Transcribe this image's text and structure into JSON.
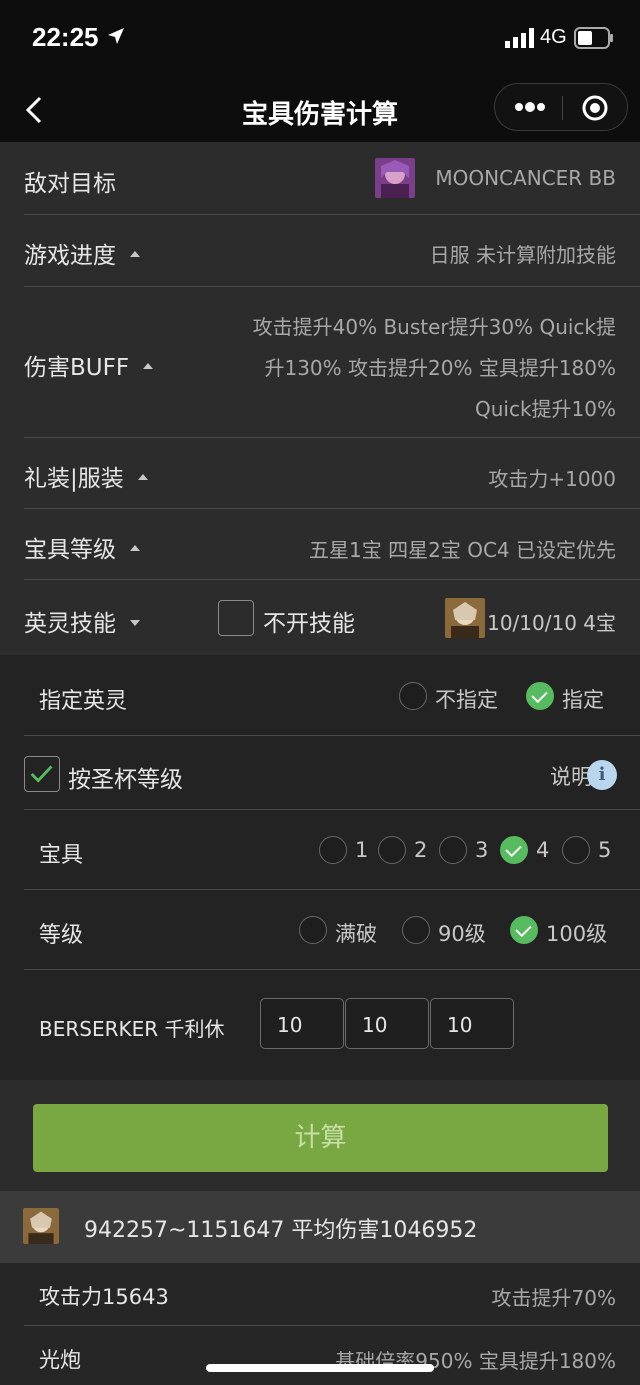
{
  "status": {
    "time": "22:25",
    "network": "4G"
  },
  "nav": {
    "title": "宝具伤害计算"
  },
  "rows": {
    "enemy": {
      "label": "敌对目标",
      "value": "MOONCANCER BB"
    },
    "progress": {
      "label": "游戏进度",
      "value": "日服 未计算附加技能"
    },
    "buff": {
      "label": "伤害BUFF",
      "line1": "攻击提升40% Buster提升30% Quick提",
      "line2": "升130% 攻击提升20% 宝具提升180%",
      "line3": "Quick提升10%"
    },
    "craft": {
      "label": "礼装|服装",
      "value": "攻击力+1000"
    },
    "np_level": {
      "label": "宝具等级",
      "value": "五星1宝 四星2宝 OC4 已设定优先"
    },
    "skill": {
      "label": "英灵技能",
      "checkbox_label": "不开技能",
      "value": "10/10/10 4宝"
    }
  },
  "panel": {
    "designate": {
      "label": "指定英灵",
      "options": [
        "不指定",
        "指定"
      ],
      "selected": "指定"
    },
    "grail": {
      "label": "按圣杯等级",
      "checked": true,
      "help": "说明",
      "info_icon": "i"
    },
    "np": {
      "label": "宝具",
      "options": [
        "1",
        "2",
        "3",
        "4",
        "5"
      ],
      "selected": "4"
    },
    "level": {
      "label": "等级",
      "options": [
        "满破",
        "90级",
        "100级"
      ],
      "selected": "100级"
    },
    "servant": {
      "label": "BERSERKER 千利休",
      "skills": [
        "10",
        "10",
        "10"
      ]
    }
  },
  "calc_button": "计算",
  "result": {
    "text": "942257~1151647 平均伤害1046952"
  },
  "details": [
    {
      "left": "攻击力15643",
      "right": "攻击提升70%"
    },
    {
      "left": "光炮",
      "right": "基础倍率950% 宝具提升180%"
    }
  ],
  "colors": {
    "accent_green": "#57bb5f",
    "button_green": "#79a843",
    "info_blue": "#b9d6ee"
  }
}
